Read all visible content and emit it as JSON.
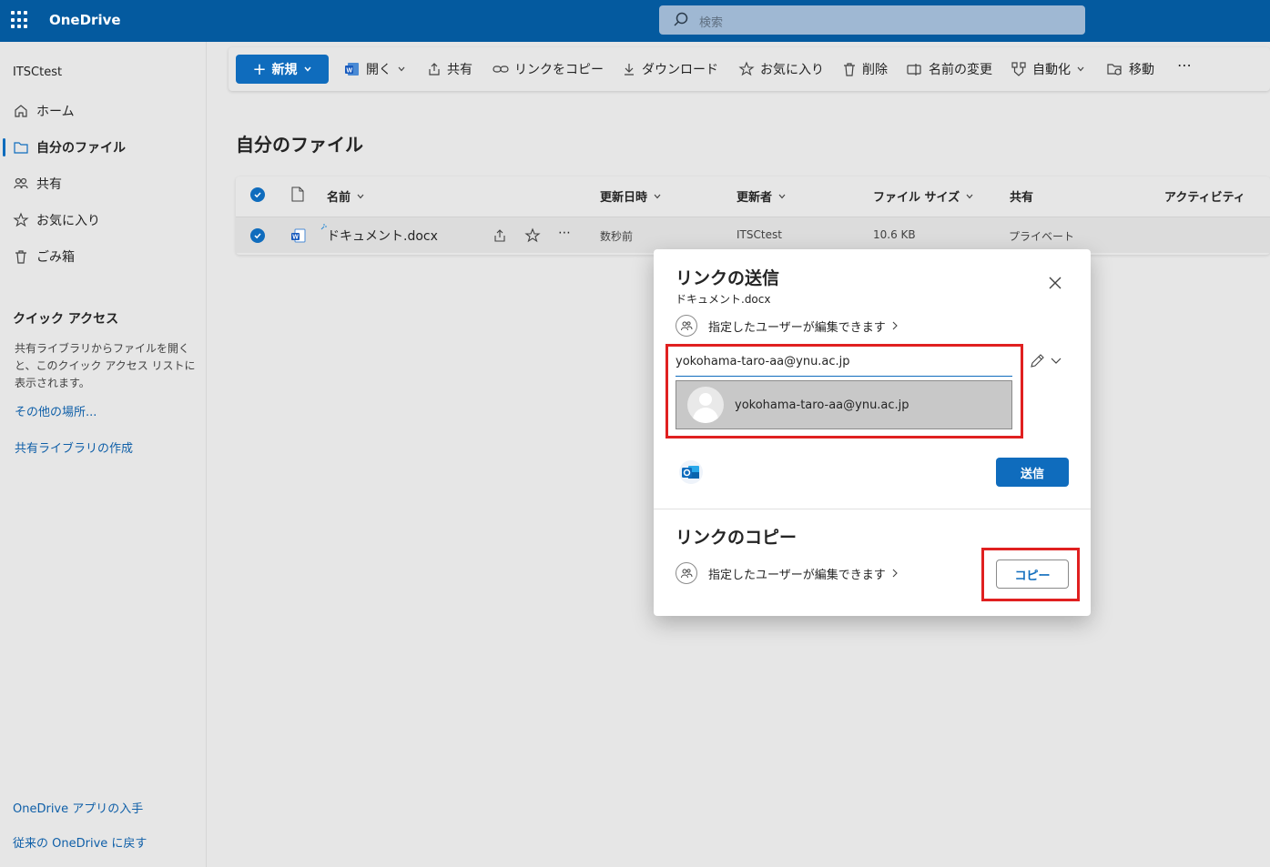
{
  "app": {
    "name": "OneDrive"
  },
  "search": {
    "placeholder": "検索"
  },
  "nav": {
    "account": "ITSCtest",
    "items": [
      {
        "label": "ホーム",
        "icon": "home-icon"
      },
      {
        "label": "自分のファイル",
        "icon": "folder-icon",
        "active": true
      },
      {
        "label": "共有",
        "icon": "people-icon"
      },
      {
        "label": "お気に入り",
        "icon": "star-icon"
      },
      {
        "label": "ごみ箱",
        "icon": "trash-icon"
      }
    ],
    "quick_access": {
      "title": "クイック アクセス",
      "description": "共有ライブラリからファイルを開くと、このクイック アクセス リストに表示されます。",
      "more_places": "その他の場所...",
      "create_library": "共有ライブラリの作成"
    },
    "get_app": "OneDrive アプリの入手",
    "back_to_classic": "従来の OneDrive に戻す"
  },
  "toolbar": {
    "new": "新規",
    "open": "開く",
    "share": "共有",
    "copy_link": "リンクをコピー",
    "download": "ダウンロード",
    "favorite": "お気に入り",
    "delete": "削除",
    "rename": "名前の変更",
    "automate": "自動化",
    "move": "移動",
    "more": "⋯"
  },
  "main": {
    "title": "自分のファイル",
    "columns": {
      "name": "名前",
      "modified": "更新日時",
      "modified_by": "更新者",
      "size": "ファイル サイズ",
      "sharing": "共有",
      "activity": "アクティビティ"
    },
    "rows": [
      {
        "name": "ドキュメント.docx",
        "modified": "数秒前",
        "modified_by": "ITSCtest",
        "size": "10.6 KB",
        "sharing": "プライベート",
        "more": "⋯"
      }
    ]
  },
  "dialog": {
    "title": "リンクの送信",
    "file": "ドキュメント.docx",
    "permission": "指定したユーザーが編集できます",
    "email_value": "yokohama-taro-aa@ynu.ac.jp",
    "suggestion": "yokohama-taro-aa@ynu.ac.jp",
    "send": "送信",
    "copy_section_title": "リンクのコピー",
    "copy_permission": "指定したユーザーが編集できます",
    "copy": "コピー"
  },
  "colors": {
    "topbar": "#045a9f",
    "accent": "#0f6cbd",
    "highlight": "#e02020"
  }
}
